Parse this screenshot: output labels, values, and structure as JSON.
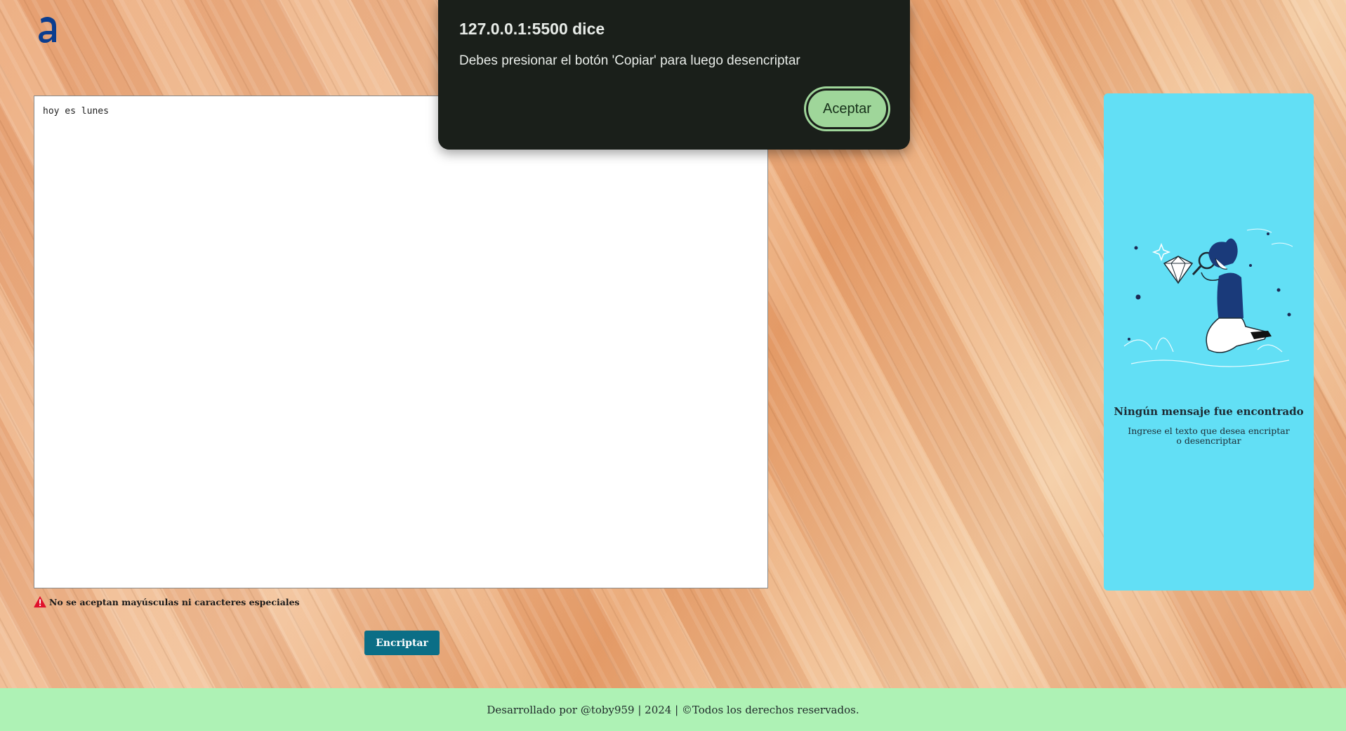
{
  "header": {
    "logo_icon": "alura-a-logo-icon",
    "logo_color": "#0a3d8f"
  },
  "editor": {
    "value": "hoy es lunes"
  },
  "warning": {
    "icon": "warning-triangle-icon",
    "icon_color": "#e0112b",
    "text": "No se aceptan mayúsculas ni caracteres especiales"
  },
  "actions": {
    "encrypt_label": "Encriptar",
    "encrypt_color": "#0b6e86"
  },
  "result_panel": {
    "background": "#62dff5",
    "illustration": "person-with-magnifier-diamond-illustration",
    "title": "Ningún mensaje fue encontrado",
    "subtitle": "Ingrese el texto que desea encriptar o desencriptar"
  },
  "footer": {
    "text": "Desarrollado por @toby959 | 2024 | ©Todos los derechos reservados.",
    "background": "#aef2b5"
  },
  "dialog": {
    "title": "127.0.0.1:5500 dice",
    "message": "Debes presionar el botón 'Copiar' para luego desencriptar",
    "ok_label": "Aceptar",
    "ok_color": "#9fd69a"
  }
}
